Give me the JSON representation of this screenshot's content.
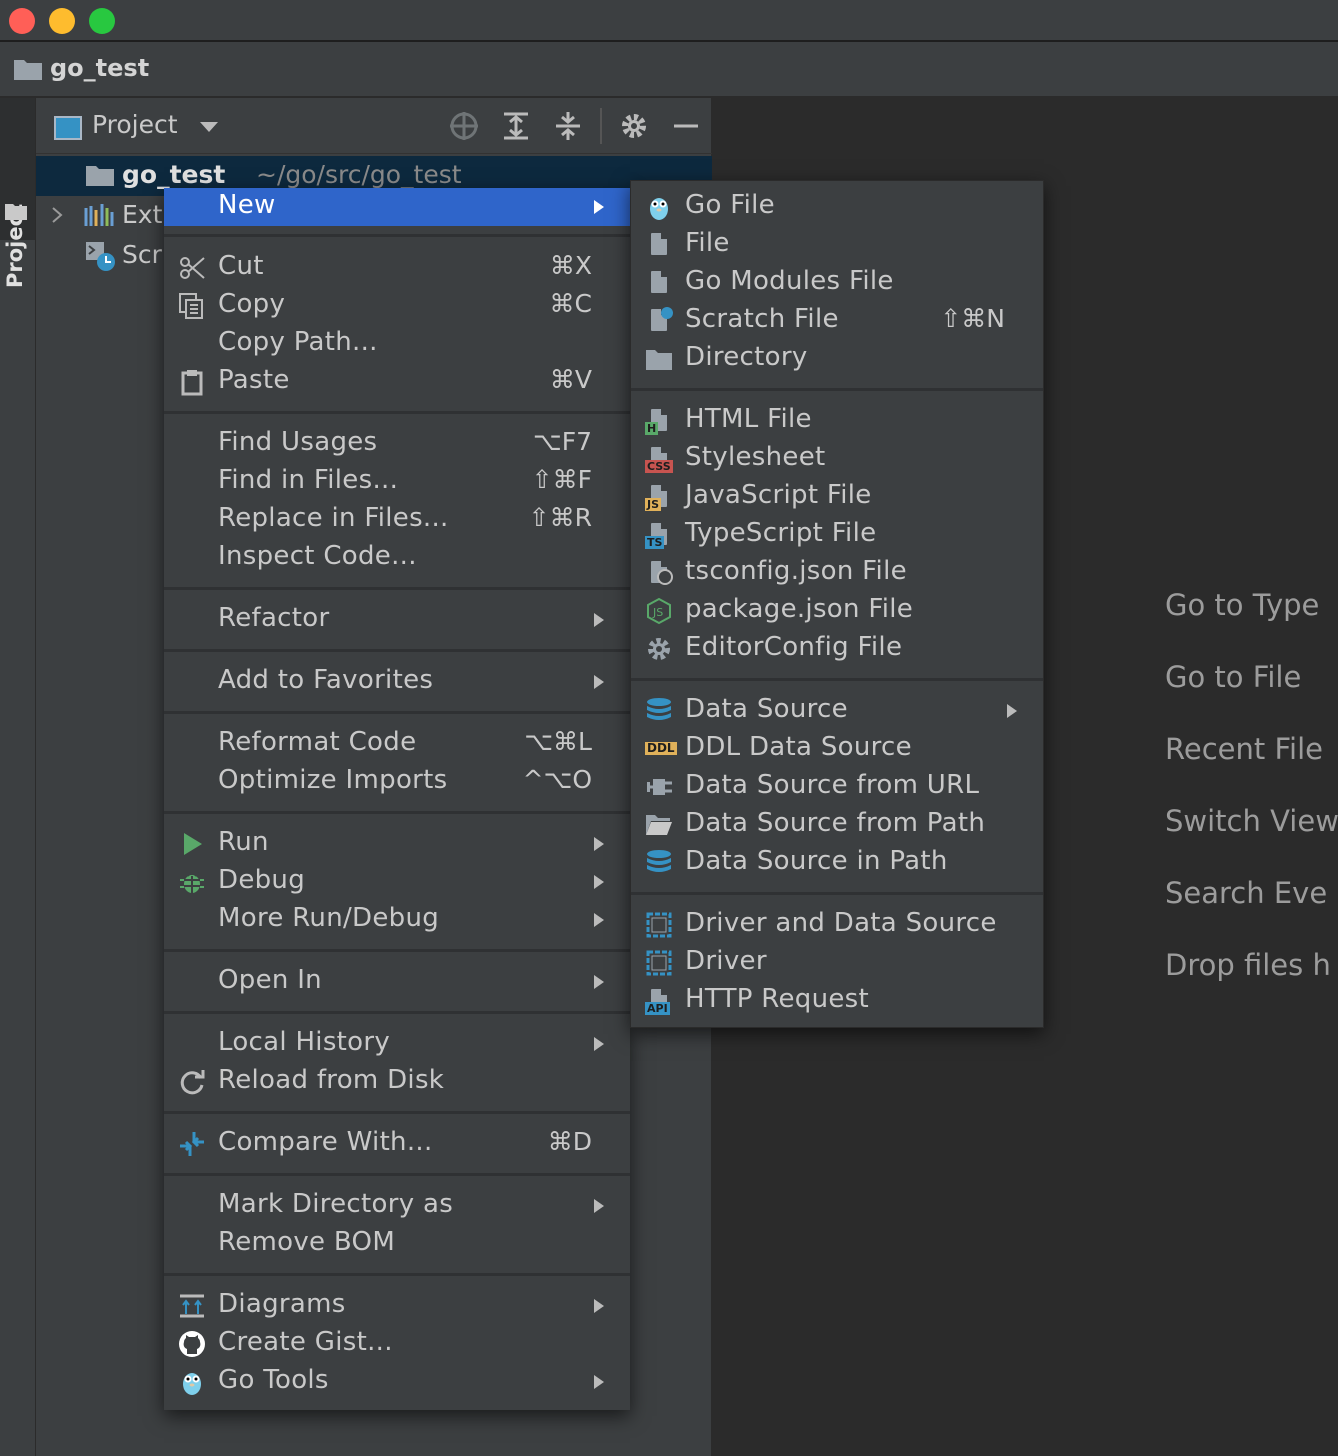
{
  "window": {
    "traffic_lights": [
      "#ff5f57",
      "#febc2e",
      "#28c840"
    ]
  },
  "navbar": {
    "project_name": "go_test"
  },
  "tool_stripe": {
    "label": "Project"
  },
  "project_panel": {
    "title": "Project",
    "tree": [
      {
        "name": "go_test",
        "path": "~/go/src/go_test"
      },
      {
        "name": "Ext"
      },
      {
        "name": "Scr"
      }
    ]
  },
  "context_menu": {
    "items": [
      {
        "label": "New"
      },
      {
        "label": "Cut",
        "shortcut": "⌘X"
      },
      {
        "label": "Copy",
        "shortcut": "⌘C"
      },
      {
        "label": "Copy Path..."
      },
      {
        "label": "Paste",
        "shortcut": "⌘V"
      },
      {
        "label": "Find Usages",
        "shortcut": "⌥F7"
      },
      {
        "label": "Find in Files...",
        "shortcut": "⇧⌘F"
      },
      {
        "label": "Replace in Files...",
        "shortcut": "⇧⌘R"
      },
      {
        "label": "Inspect Code..."
      },
      {
        "label": "Refactor"
      },
      {
        "label": "Add to Favorites"
      },
      {
        "label": "Reformat Code",
        "shortcut": "⌥⌘L"
      },
      {
        "label": "Optimize Imports",
        "shortcut": "^⌥O"
      },
      {
        "label": "Run"
      },
      {
        "label": "Debug"
      },
      {
        "label": "More Run/Debug"
      },
      {
        "label": "Open In"
      },
      {
        "label": "Local History"
      },
      {
        "label": "Reload from Disk"
      },
      {
        "label": "Compare With...",
        "shortcut": "⌘D"
      },
      {
        "label": "Mark Directory as"
      },
      {
        "label": "Remove BOM"
      },
      {
        "label": "Diagrams"
      },
      {
        "label": "Create Gist..."
      },
      {
        "label": "Go Tools"
      }
    ]
  },
  "new_submenu": {
    "items": [
      {
        "label": "Go File"
      },
      {
        "label": "File"
      },
      {
        "label": "Go Modules File"
      },
      {
        "label": "Scratch File",
        "shortcut": "⇧⌘N"
      },
      {
        "label": "Directory"
      },
      {
        "label": "HTML File",
        "tag": "H"
      },
      {
        "label": "Stylesheet",
        "tag": "CSS"
      },
      {
        "label": "JavaScript File",
        "tag": "JS"
      },
      {
        "label": "TypeScript File",
        "tag": "TS"
      },
      {
        "label": "tsconfig.json File"
      },
      {
        "label": "package.json File"
      },
      {
        "label": "EditorConfig File"
      },
      {
        "label": "Data Source"
      },
      {
        "label": "DDL Data Source",
        "tag": "DDL"
      },
      {
        "label": "Data Source from URL"
      },
      {
        "label": "Data Source from Path"
      },
      {
        "label": "Data Source in Path"
      },
      {
        "label": "Driver and Data Source"
      },
      {
        "label": "Driver"
      },
      {
        "label": "HTTP Request",
        "tag": "API"
      }
    ]
  },
  "editor_hints": [
    "Go to Type",
    "Go to File",
    "Recent File",
    "Switch View",
    "Search Eve",
    "Drop files h"
  ],
  "colors": {
    "accent": "#2f65ca",
    "selection": "#0d293e",
    "panel": "#3c3f41",
    "editor": "#2b2b2b"
  }
}
